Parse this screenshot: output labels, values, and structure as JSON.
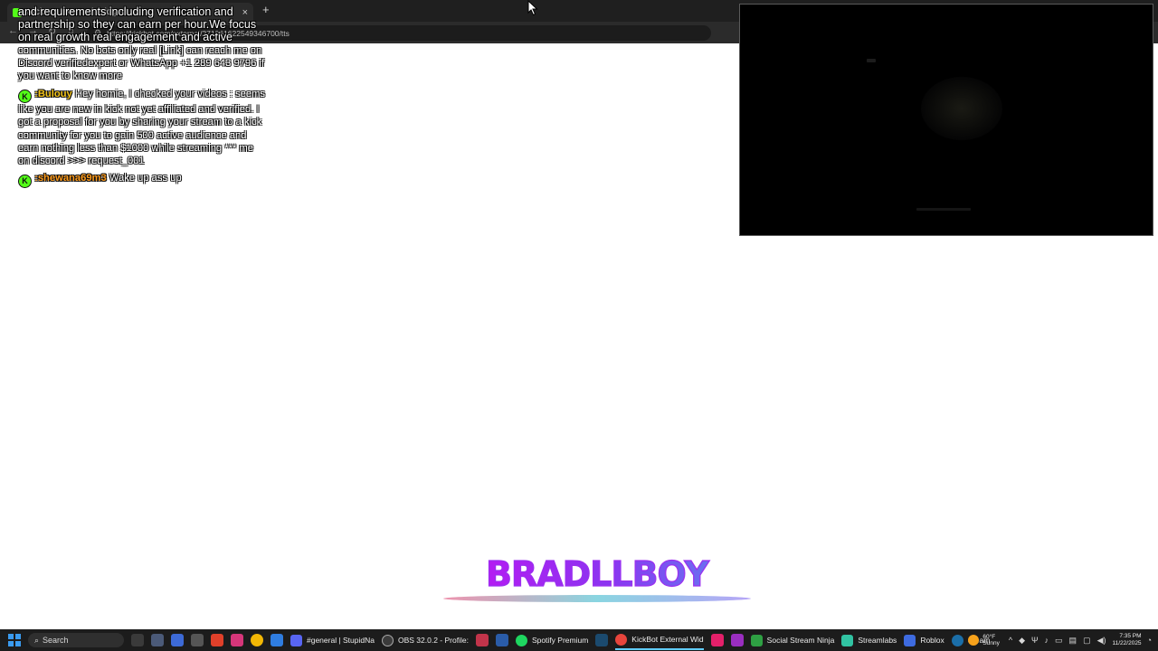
{
  "browser": {
    "tab_title": "KickBot External Widget",
    "tab_close": "×",
    "new_tab": "+",
    "url": "https://kickbot.com/external/271361622549346700/tts"
  },
  "chat": {
    "overflow_text": "and requirements including verification and partnership so they can earn per hour.We focus on real growth real engagement and active",
    "messages": [
      {
        "text": "communities. No bots only real [Link] can reach me on Discord verifiedexpert or WhatsApp +1 289 643 9796 if you want to know more"
      },
      {
        "username": ":Bulouy",
        "text": "Hey homie, I checked your videos : seems like you are new in kick not yet affiliated and verified. I got a proposal for you by sharing your stream to a kick community for you to gain 500 active audience and earn nothing less than $1000 while streaming *** me on discord >>> request_001",
        "color": "#f5c518"
      },
      {
        "username": ":shewana69m3",
        "text": "Wake up ass up",
        "color": "#ff9b1a"
      }
    ]
  },
  "logo": {
    "text": "BRADLLBOY"
  },
  "taskbar": {
    "search_label": "Search",
    "apps": [
      {
        "label": "#general | StupidNa",
        "icon": "discord-icon",
        "color": "#5865f2"
      },
      {
        "label": "OBS 32.0.2 - Profile:",
        "icon": "obs-icon",
        "color": "#3b3b3b"
      },
      {
        "label": "Spotify Premium",
        "icon": "spotify-icon",
        "color": "#1ed760"
      },
      {
        "label": "KickBot External Wid",
        "icon": "chrome-icon",
        "color": "#e8453c"
      },
      {
        "label": "Social Stream Ninja",
        "icon": "social-stream-icon",
        "color": "#2ea043"
      },
      {
        "label": "Streamlabs",
        "icon": "streamlabs-icon",
        "color": "#31c3a2"
      },
      {
        "label": "Roblox",
        "icon": "roblox-icon",
        "color": "#3e6be0"
      },
      {
        "label": "Steam",
        "icon": "steam-icon",
        "color": "#1b6ea8"
      }
    ],
    "weather_temp": "60°F",
    "weather_cond": "Sunny",
    "time": "7:35 PM",
    "date": "11/22/2025"
  }
}
